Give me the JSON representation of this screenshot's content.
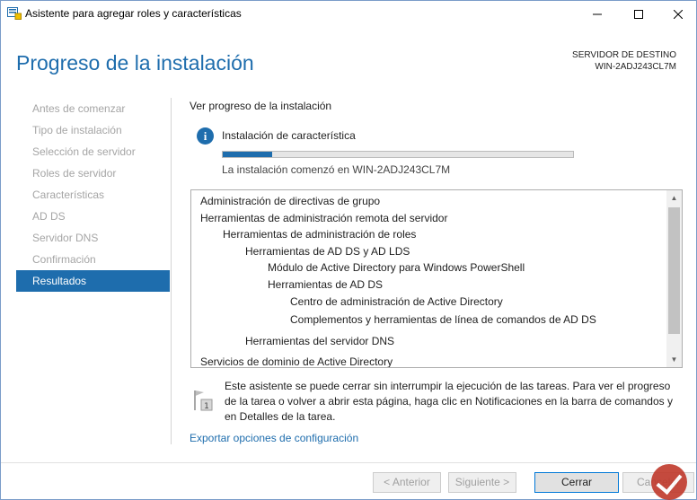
{
  "window": {
    "title": "Asistente para agregar roles y características",
    "controls": {
      "minimize": "—",
      "maximize": "☐",
      "close": "✕"
    }
  },
  "header": {
    "title": "Progreso de la instalación",
    "destination_label": "SERVIDOR DE DESTINO",
    "destination_server": "WIN-2ADJ243CL7M"
  },
  "nav": {
    "items": [
      {
        "label": "Antes de comenzar",
        "active": false
      },
      {
        "label": "Tipo de instalación",
        "active": false
      },
      {
        "label": "Selección de servidor",
        "active": false
      },
      {
        "label": "Roles de servidor",
        "active": false
      },
      {
        "label": "Características",
        "active": false
      },
      {
        "label": "AD DS",
        "active": false
      },
      {
        "label": "Servidor DNS",
        "active": false
      },
      {
        "label": "Confirmación",
        "active": false
      },
      {
        "label": "Resultados",
        "active": true
      }
    ]
  },
  "main": {
    "section_label": "Ver progreso de la instalación",
    "status_text": "Instalación de característica",
    "progress_fraction": 0.14,
    "start_text": "La instalación comenzó en WIN-2ADJ243CL7M",
    "features": [
      {
        "label": "Administración de directivas de grupo",
        "level": 0
      },
      {
        "label": "Herramientas de administración remota del servidor",
        "level": 0
      },
      {
        "label": "Herramientas de administración de roles",
        "level": 1
      },
      {
        "label": "Herramientas de AD DS y AD LDS",
        "level": 2
      },
      {
        "label": "Módulo de Active Directory para Windows PowerShell",
        "level": 3
      },
      {
        "label": "Herramientas de AD DS",
        "level": 3
      },
      {
        "label": "Centro de administración de Active Directory",
        "level": 4
      },
      {
        "label": "Complementos y herramientas de línea de comandos de AD DS",
        "level": 4
      },
      {
        "label": "Herramientas del servidor DNS",
        "level": 2
      },
      {
        "label": "Servicios de dominio de Active Directory",
        "level": 0
      }
    ],
    "note_icon_number": "1",
    "note": "Este asistente se puede cerrar sin interrumpir la ejecución de las tareas. Para ver el progreso de la tarea o volver a abrir esta página, haga clic en Notificaciones en la barra de comandos y en Detalles de la tarea.",
    "export_link": "Exportar opciones de configuración"
  },
  "footer": {
    "prev_label": "< Anterior",
    "next_label": "Siguiente >",
    "close_label": "Cerrar",
    "cancel_label": "Cancelar"
  },
  "colors": {
    "accent": "#1e6dad",
    "nav_inactive": "#a5a5a5"
  }
}
